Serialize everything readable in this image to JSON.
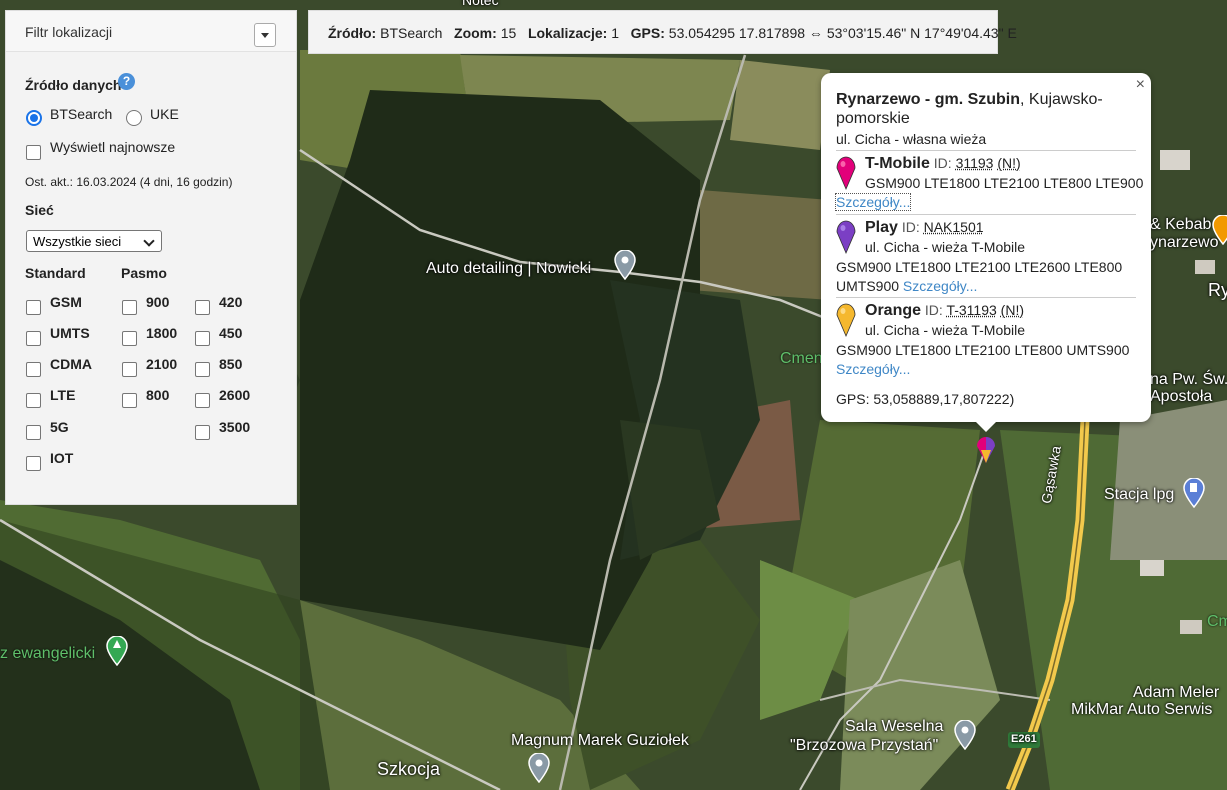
{
  "map": {
    "labels": [
      {
        "text": "Auto detailing | Nowicki"
      },
      {
        "text": "Magnum Marek Guziołek"
      },
      {
        "text": "Szkocja"
      },
      {
        "text": "Sala Weselna"
      },
      {
        "text": "\"Brzozowa Przystań\""
      },
      {
        "text": "Stacja lpg"
      },
      {
        "text": "Adam Meler"
      },
      {
        "text": "MikMar Auto Serwis"
      },
      {
        "text": "z ewangelicki"
      },
      {
        "text": "Cmen"
      },
      {
        "text": "& Kebab"
      },
      {
        "text": "ynarzewo"
      },
      {
        "text": "na Pw. Św."
      },
      {
        "text": "Apostoła"
      },
      {
        "text": "Gąsawka"
      },
      {
        "text": "E261"
      },
      {
        "text": "Noteć"
      },
      {
        "text": "Ry"
      },
      {
        "text": "Cm"
      }
    ]
  },
  "filter": {
    "title": "Filtr lokalizacji",
    "source_label": "Źródło danych",
    "help_icon": "?",
    "source_options": [
      "BTSearch",
      "UKE"
    ],
    "source_selected": "BTSearch",
    "show_newest": "Wyświetl najnowsze",
    "last_update": "Ost. akt.: 16.03.2024 (4 dni, 16 godzin)",
    "network_label": "Sieć",
    "network_value": "Wszystkie sieci",
    "standard_label": "Standard",
    "band_label": "Pasmo",
    "standards": [
      "GSM",
      "UMTS",
      "CDMA",
      "LTE",
      "5G",
      "IOT"
    ],
    "bands_col1": [
      "900",
      "1800",
      "2100",
      "800"
    ],
    "bands_col2": [
      "420",
      "450",
      "850",
      "2600",
      "3500"
    ]
  },
  "status": {
    "source_key": "Źródło:",
    "source_val": "BTSearch",
    "zoom_key": "Zoom:",
    "zoom_val": "15",
    "loc_key": "Lokalizacje:",
    "loc_val": "1",
    "gps_key": "GPS:",
    "gps_val": "53.054295 17.817898 ⇔ 53°03'15.46\" N 17°49'04.43\" E"
  },
  "popup": {
    "close": "×",
    "place_bold": "Rynarzewo - gm. Szubin",
    "place_rest1": ", Kujawsko-",
    "place_rest2": "pomorskie",
    "address": "ul. Cicha - własna wieża",
    "operators": [
      {
        "name": "T-Mobile",
        "id_label": "ID:",
        "id": "31193",
        "flag": "(N!)",
        "location": "",
        "bands": "GSM900 LTE1800 LTE2100 LTE800 LTE900",
        "bands2": "",
        "details": "Szczegóły...",
        "color": "#e2007a"
      },
      {
        "name": "Play",
        "id_label": "ID:",
        "id": "NAK1501",
        "flag": "",
        "location": "ul. Cicha - wieża T-Mobile",
        "bands": "GSM900 LTE1800 LTE2100 LTE2600 LTE800",
        "bands2": "UMTS900",
        "details": "Szczegóły...",
        "color": "#7b3fc4"
      },
      {
        "name": "Orange",
        "id_label": "ID:",
        "id": "T-31193",
        "flag": "(N!)",
        "location": "ul. Cicha - wieża T-Mobile",
        "bands": "GSM900 LTE1800 LTE2100 LTE800 UMTS900",
        "bands2": "",
        "details": "Szczegóły...",
        "color": "#f5b82e"
      }
    ],
    "gps": "GPS: 53,058889,17,807222)"
  },
  "colors": {
    "link": "#3f87c6",
    "radio_accent": "#1a73e8",
    "road_yellow": "#f2c94c"
  }
}
